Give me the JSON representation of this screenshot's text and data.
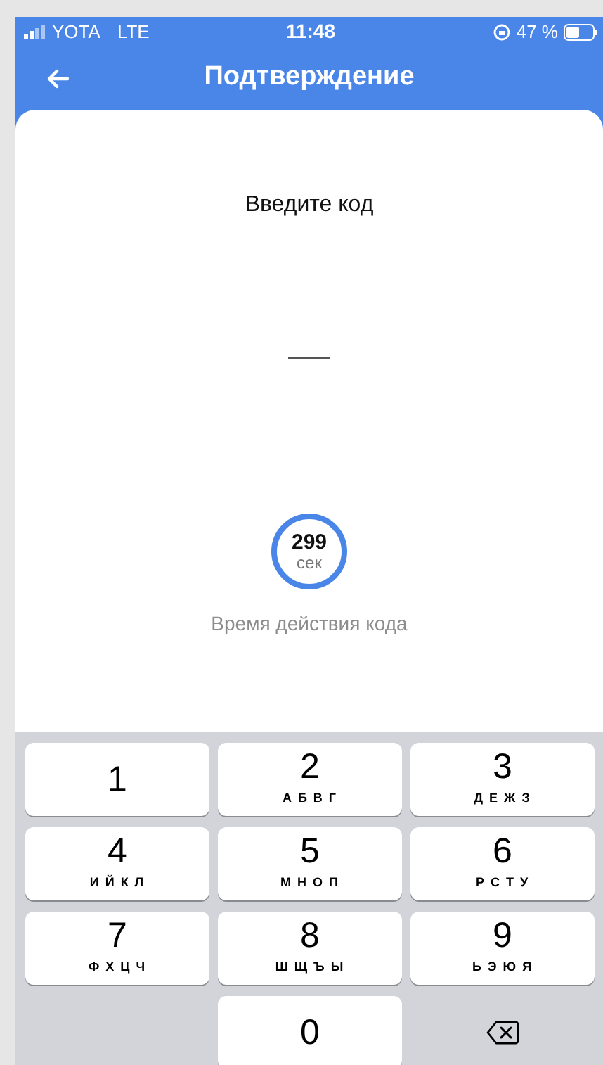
{
  "status_bar": {
    "carrier": "YOTA",
    "network": "LTE",
    "time": "11:48",
    "battery": "47 %"
  },
  "header": {
    "title": "Подтверждение"
  },
  "prompt": "Введите код",
  "timer": {
    "value": "299",
    "unit": "сек",
    "caption": "Время действия кода"
  },
  "keypad": [
    {
      "kind": "digit",
      "digit": "1"
    },
    {
      "kind": "digit",
      "digit": "2",
      "letters": "А Б В Г"
    },
    {
      "kind": "digit",
      "digit": "3",
      "letters": "Д Е Ж З"
    },
    {
      "kind": "digit",
      "digit": "4",
      "letters": "И Й К Л"
    },
    {
      "kind": "digit",
      "digit": "5",
      "letters": "М Н О П"
    },
    {
      "kind": "digit",
      "digit": "6",
      "letters": "Р С Т У"
    },
    {
      "kind": "digit",
      "digit": "7",
      "letters": "Ф Х Ц Ч"
    },
    {
      "kind": "digit",
      "digit": "8",
      "letters": "Ш Щ Ъ Ы"
    },
    {
      "kind": "digit",
      "digit": "9",
      "letters": "Ь Э Ю Я"
    },
    {
      "kind": "blank"
    },
    {
      "kind": "digit",
      "digit": "0"
    },
    {
      "kind": "backspace"
    }
  ]
}
